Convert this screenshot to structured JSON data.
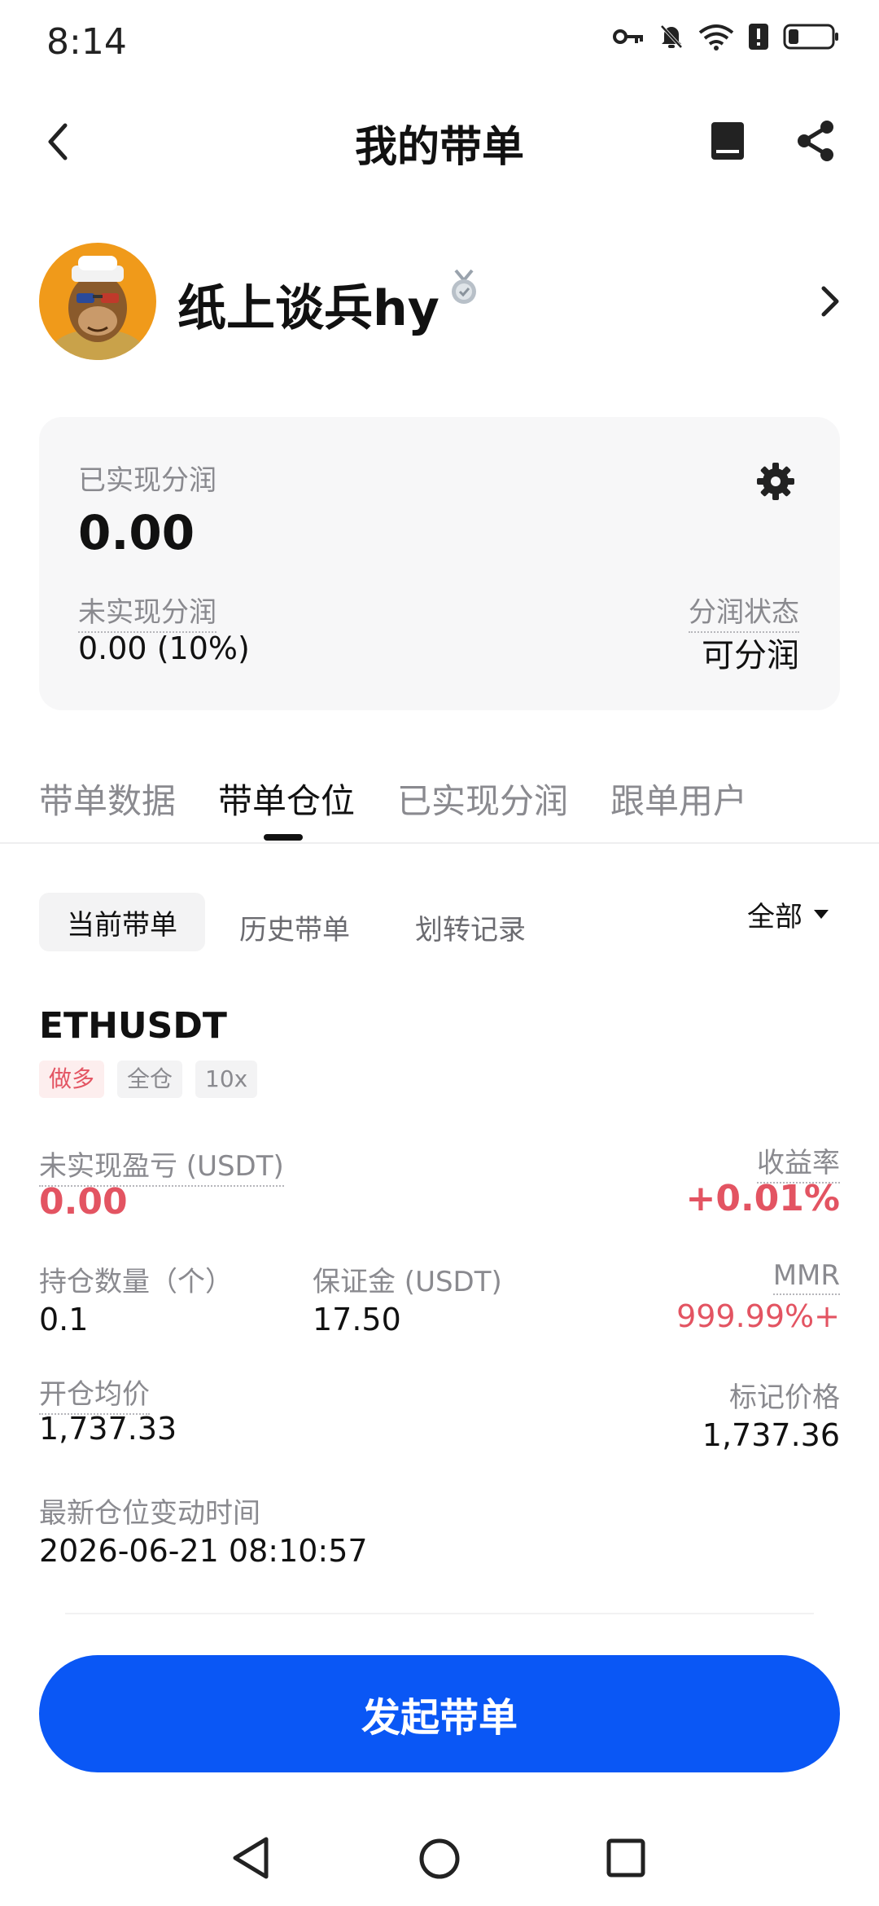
{
  "status_bar": {
    "time": "8:14",
    "icons": [
      "key-icon",
      "bell-off-icon",
      "wifi-icon",
      "alert-icon",
      "battery-icon"
    ]
  },
  "header": {
    "title": "我的带单",
    "back_icon": "chevron-left-icon",
    "book_icon": "book-icon",
    "share_icon": "share-icon"
  },
  "profile": {
    "name": "纸上谈兵hy",
    "avatar": "ape-avatar",
    "badge_icon": "medal-icon"
  },
  "summary": {
    "realized_label": "已实现分润",
    "realized_value": "0.00",
    "unrealized_label": "未实现分润",
    "unrealized_value": "0.00 (10%)",
    "status_label": "分润状态",
    "status_value": "可分润",
    "settings_icon": "gear-icon"
  },
  "tabs": [
    {
      "label": "带单数据",
      "active": false
    },
    {
      "label": "带单仓位",
      "active": true
    },
    {
      "label": "已实现分润",
      "active": false
    },
    {
      "label": "跟单用户",
      "active": false
    }
  ],
  "subtabs": {
    "items": [
      "当前带单",
      "历史带单",
      "划转记录"
    ],
    "active": "当前带单",
    "filter_label": "全部"
  },
  "position": {
    "symbol": "ETHUSDT",
    "tags": [
      "做多",
      "全仓",
      "10x"
    ],
    "unrealized_pnl_label": "未实现盈亏 (USDT)",
    "unrealized_pnl_value": "0.00",
    "roi_label": "收益率",
    "roi_value": "+0.01%",
    "qty_label": "持仓数量（个）",
    "qty_value": "0.1",
    "margin_label": "保证金 (USDT)",
    "margin_value": "17.50",
    "mmr_label": "MMR",
    "mmr_value": "999.99%+",
    "entry_label": "开仓均价",
    "entry_value": "1,737.33",
    "mark_label": "标记价格",
    "mark_value": "1,737.36",
    "time_label": "最新仓位变动时间",
    "time_value": "2026-06-21 08:10:57"
  },
  "primary_button": "发起带单",
  "colors": {
    "accent": "#0a57f5",
    "negative": "#e35462",
    "muted": "#8a8a8f",
    "card_bg": "#f7f7f8"
  }
}
